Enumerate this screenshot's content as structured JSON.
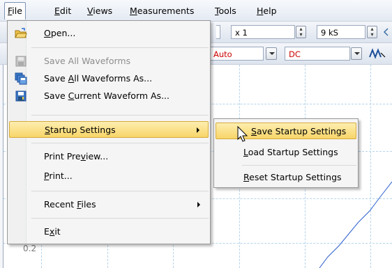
{
  "menubar": {
    "items": [
      {
        "label_pre": "",
        "accel": "F",
        "label_post": "ile"
      },
      {
        "label_pre": "",
        "accel": "E",
        "label_post": "dit"
      },
      {
        "label_pre": "",
        "accel": "V",
        "label_post": "iews"
      },
      {
        "label_pre": "",
        "accel": "M",
        "label_post": "easurements"
      },
      {
        "label_pre": "",
        "accel": "T",
        "label_post": "ools"
      },
      {
        "label_pre": "",
        "accel": "H",
        "label_post": "elp"
      }
    ]
  },
  "toolbar": {
    "zoom_value": "x 1",
    "samples_value": "9 kS",
    "coupling_left_value": "Auto",
    "coupling_value": "DC"
  },
  "plot": {
    "y_label_bottom": "0.2"
  },
  "file_menu": {
    "items": [
      {
        "pre": "",
        "accel": "O",
        "post": "pen...",
        "icon": "open-folder-icon",
        "disabled": false
      },
      {
        "pre": "Save All Waveforms",
        "accel": "",
        "post": "",
        "icon": "disk-icon",
        "disabled": true
      },
      {
        "pre": "Save ",
        "accel": "A",
        "post": "ll Waveforms As...",
        "icon": "save-all-icon",
        "disabled": false
      },
      {
        "pre": "Save ",
        "accel": "C",
        "post": "urrent Waveform As...",
        "icon": "save-current-icon",
        "disabled": false
      },
      {
        "pre": "",
        "accel": "S",
        "post": "tartup Settings",
        "icon": "",
        "disabled": false
      },
      {
        "pre": "Print Pre",
        "accel": "v",
        "post": "iew...",
        "icon": "",
        "disabled": false
      },
      {
        "pre": "",
        "accel": "P",
        "post": "rint...",
        "icon": "",
        "disabled": false
      },
      {
        "pre": "Recent ",
        "accel": "F",
        "post": "iles",
        "icon": "",
        "disabled": false
      },
      {
        "pre": "E",
        "accel": "x",
        "post": "it",
        "icon": "",
        "disabled": false
      }
    ]
  },
  "submenu": {
    "items": [
      {
        "pre": "",
        "accel": "S",
        "post": "ave Startup Settings"
      },
      {
        "pre": "",
        "accel": "L",
        "post": "oad Startup Settings"
      },
      {
        "pre": "",
        "accel": "R",
        "post": "eset Startup Settings"
      }
    ]
  },
  "colors": {
    "highlight": "#f8d568",
    "grid": "#b5d4ec",
    "trace": "#2b5fcf"
  }
}
